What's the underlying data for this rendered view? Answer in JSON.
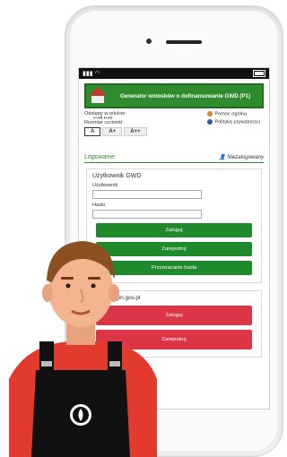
{
  "header": {
    "title": "Generator wniosków o dofinansowanie GWD (P1)"
  },
  "prefs": {
    "spacing_label": "Odstępy w tekście:",
    "spacing_glyphs": "⟷A    ⟷≡",
    "font_size_label": "Rozmiar czcionki:",
    "sizes": [
      "A",
      "A+",
      "A++"
    ]
  },
  "help": {
    "general_help": "Pomoc ogólna",
    "privacy": "Polityka prywatności"
  },
  "login": {
    "section_title": "Logowanie",
    "user_status": "Niezalogowany",
    "box_title": "Użytkownik GWD",
    "username_label": "Użytkownik",
    "password_label": "Hasło",
    "login_button": "Zaloguj",
    "register_button": "Zarejestruj",
    "reset_button": "Przywracanie hasła"
  },
  "login_gov": {
    "title_fragment": "owy / login.gov.pl",
    "login_button": "Zaloguj",
    "register_button": "Zarejestruj"
  },
  "colors": {
    "green": "#1f8a2b",
    "red": "#dc3545",
    "header": "#2e8b2e"
  }
}
